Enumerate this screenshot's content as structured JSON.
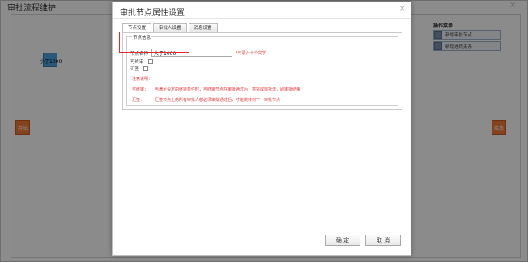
{
  "background": {
    "title": "审批流程维护",
    "close_glyph": "×",
    "nodes": {
      "start_label": "开始",
      "end_label": "结束",
      "condition_label": "小于1000"
    },
    "operation_menu": {
      "title": "操作菜单",
      "items": [
        {
          "label": "新增审批节点",
          "icon": "node-icon"
        },
        {
          "label": "新增连线关系",
          "icon": "link-icon"
        }
      ]
    }
  },
  "dialog": {
    "title": "审批节点属性设置",
    "close_glyph": "×",
    "tabs": [
      {
        "label": "节点设置",
        "active": true
      },
      {
        "label": "审批人设置",
        "active": false
      },
      {
        "label": "消息设置",
        "active": false
      }
    ],
    "fieldset_legend": "节点信息",
    "node_name_label": "节点名称",
    "node_name_value": "大于1000",
    "node_name_hint": "*可录入十个文字",
    "can_end_label": "可终审",
    "merge_label": "汇签",
    "notes_title": "注意说明：",
    "note_can_end_key": "可终审：",
    "note_can_end_text": "当满足设定的终审条件时，可终审节点在审批通过后，将完成审批流，即审批结束",
    "note_merge_key": "汇签：",
    "note_merge_text": "汇签节点上的所有审批人都必须审批通过后，才能跳转到下一审批节点",
    "ok_label": "确 定",
    "cancel_label": "取 消"
  },
  "colors": {
    "accent_red": "#e4393c",
    "node_blue": "#4aa3df",
    "node_orange": "#f0783a"
  }
}
